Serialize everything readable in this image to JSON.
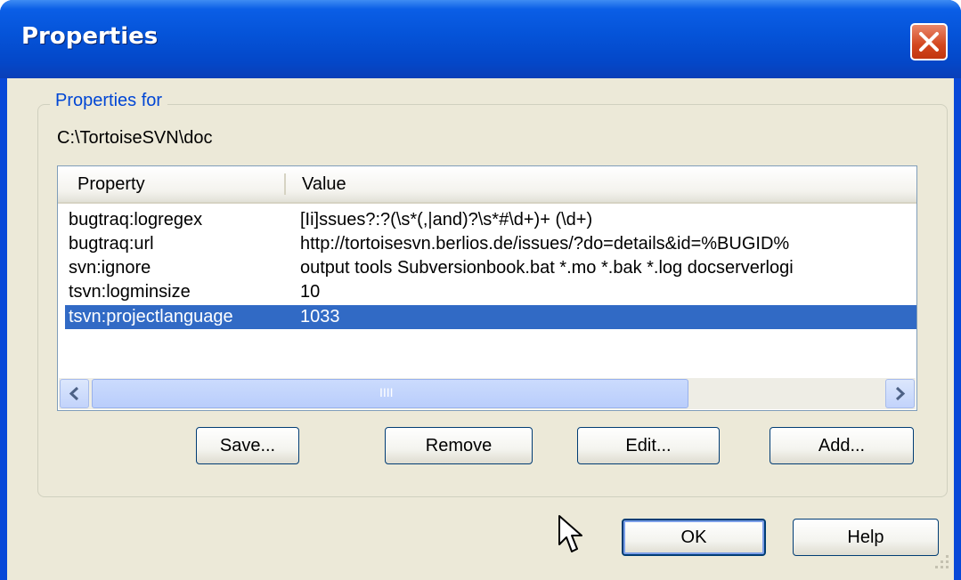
{
  "window": {
    "title": "Properties"
  },
  "group": {
    "legend": "Properties for",
    "path": "C:\\TortoiseSVN\\doc"
  },
  "list": {
    "columns": [
      "Property",
      "Value"
    ],
    "rows": [
      {
        "property": "bugtraq:logregex",
        "value": "[Ii]ssues?:?(\\s*(,|and)?\\s*#\\d+)+ (\\d+)",
        "selected": false
      },
      {
        "property": "bugtraq:url",
        "value": "http://tortoisesvn.berlios.de/issues/?do=details&id=%BUGID%",
        "selected": false
      },
      {
        "property": "svn:ignore",
        "value": "output tools Subversionbook.bat *.mo *.bak *.log docserverlogi",
        "selected": false
      },
      {
        "property": "tsvn:logminsize",
        "value": "10",
        "selected": false
      },
      {
        "property": "tsvn:projectlanguage",
        "value": "1033",
        "selected": true
      }
    ],
    "scroll_thumb_grip": "IIII"
  },
  "buttons": {
    "save": "Save...",
    "remove": "Remove",
    "edit": "Edit...",
    "add": "Add...",
    "ok": "OK",
    "help": "Help"
  },
  "icons": {
    "close": "close-icon",
    "scroll_left": "arrow-left-icon",
    "scroll_right": "arrow-right-icon",
    "cursor": "mouse-pointer-icon",
    "grip": "resize-grip-icon"
  },
  "colors": {
    "titlebar": "#0553d8",
    "selection": "#316ac5",
    "dialog_bg": "#ece9d8",
    "group_label": "#0046d5"
  }
}
